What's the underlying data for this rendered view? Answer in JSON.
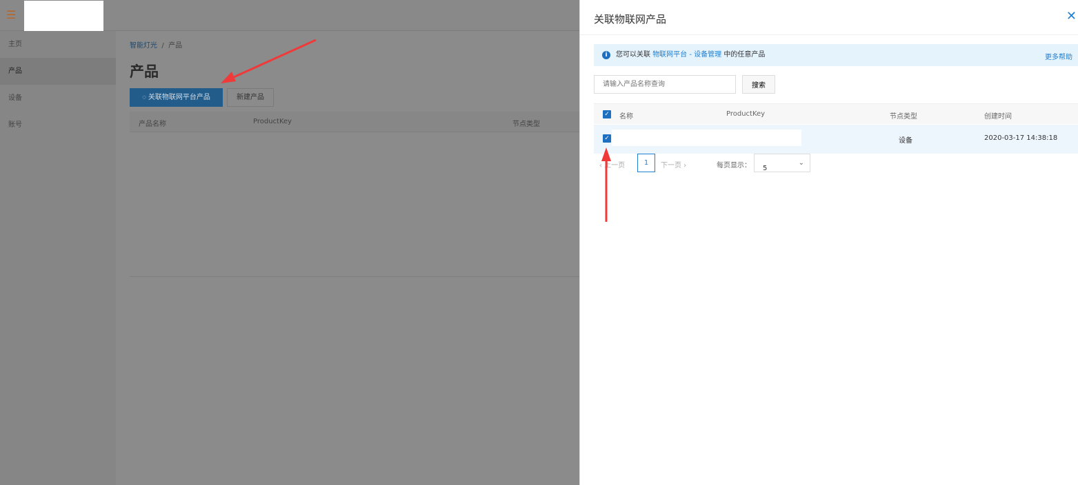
{
  "sidebar": {
    "items": [
      {
        "label": "主页"
      },
      {
        "label": "产品"
      },
      {
        "label": "设备"
      },
      {
        "label": "账号"
      }
    ],
    "active": "产品"
  },
  "main": {
    "breadcrumb": [
      "智能灯光",
      "产品"
    ],
    "breadcrumb_sep": "/",
    "title": "产品",
    "link_button": "关联物联网平台产品",
    "new_button": "新建产品",
    "columns": [
      "产品名称",
      "ProductKey",
      "节点类型"
    ]
  },
  "drawer": {
    "title": "关联物联网产品",
    "close": "✕",
    "info": {
      "prefix": "您可以关联",
      "link": "物联网平台 - 设备管理",
      "suffix": "中的任意产品",
      "help": "更多帮助"
    },
    "search": {
      "placeholder": "请输入产品名称查询",
      "button": "搜索"
    },
    "columns": [
      "名称",
      "ProductKey",
      "节点类型",
      "创建时间"
    ],
    "rows": [
      {
        "name": "",
        "product_key": "",
        "node_type": "设备",
        "created": "2020-03-17 14:38:18",
        "checked": true
      }
    ],
    "pagination": {
      "prev": "上一页",
      "page": "1",
      "next": "下一页",
      "page_size_label": "每页显示：",
      "page_size": "5"
    }
  },
  "colors": {
    "accent": "#1f7fd0",
    "annotation_arrow": "#f03a3a"
  }
}
